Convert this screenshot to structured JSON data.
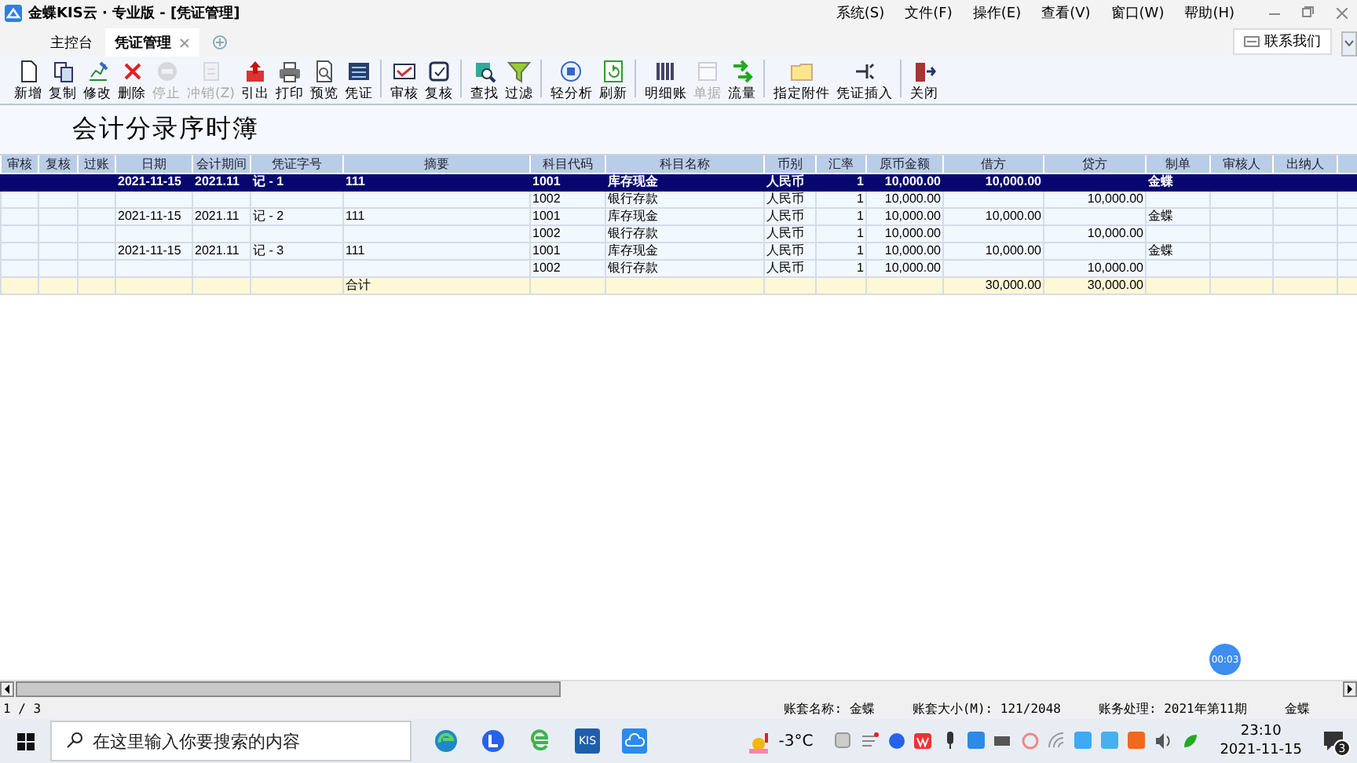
{
  "window": {
    "title": "金蝶KIS云 · 专业版 - [凭证管理]"
  },
  "menu": [
    "系统(S)",
    "文件(F)",
    "操作(E)",
    "查看(V)",
    "窗口(W)",
    "帮助(H)"
  ],
  "tabs": [
    {
      "label": "主控台",
      "selected": false
    },
    {
      "label": "凭证管理",
      "selected": true
    }
  ],
  "contact_button": "联系我们",
  "toolbar": [
    {
      "label": "新增",
      "disabled": false
    },
    {
      "label": "复制",
      "disabled": false
    },
    {
      "label": "修改",
      "disabled": false
    },
    {
      "label": "删除",
      "disabled": false
    },
    {
      "label": "停止",
      "disabled": true
    },
    {
      "label": "冲销(Z)",
      "disabled": true
    },
    {
      "label": "引出",
      "disabled": false
    },
    {
      "label": "打印",
      "disabled": false
    },
    {
      "label": "预览",
      "disabled": false
    },
    {
      "label": "凭证",
      "disabled": false
    },
    {
      "label": "审核",
      "disabled": false,
      "group_start": true
    },
    {
      "label": "复核",
      "disabled": false
    },
    {
      "label": "查找",
      "disabled": false,
      "group_start": true
    },
    {
      "label": "过滤",
      "disabled": false
    },
    {
      "label": "轻分析",
      "disabled": false,
      "group_start": true
    },
    {
      "label": "刷新",
      "disabled": false
    },
    {
      "label": "明细账",
      "disabled": false,
      "group_start": true
    },
    {
      "label": "单据",
      "disabled": true
    },
    {
      "label": "流量",
      "disabled": false
    },
    {
      "label": "指定附件",
      "disabled": false,
      "group_start": true
    },
    {
      "label": "凭证插入",
      "disabled": false
    },
    {
      "label": "关闭",
      "disabled": false,
      "group_start": true
    }
  ],
  "report_title": "会计分录序时簿",
  "table": {
    "columns": [
      "审核",
      "复核",
      "过账",
      "日期",
      "会计期间",
      "凭证字号",
      "摘要",
      "科目代码",
      "科目名称",
      "币别",
      "汇率",
      "原币金额",
      "借方",
      "贷方",
      "制单",
      "审核人",
      "出纳人"
    ],
    "rows": [
      {
        "kind": "entry",
        "selected": true,
        "date": "2021-11-15",
        "period": "2021.11",
        "voucher_no": "记 - 1",
        "summary": "111",
        "account_code": "1001",
        "account_name": "库存现金",
        "currency": "人民币",
        "rate": "1",
        "original_amount": "10,000.00",
        "debit": "10,000.00",
        "preparer": "金蝶"
      },
      {
        "kind": "entry",
        "selected": false,
        "account_code": "1002",
        "account_name": "银行存款",
        "currency": "人民币",
        "rate": "1",
        "original_amount": "10,000.00",
        "credit": "10,000.00"
      },
      {
        "kind": "entry",
        "selected": false,
        "date": "2021-11-15",
        "period": "2021.11",
        "voucher_no": "记 - 2",
        "summary": "111",
        "account_code": "1001",
        "account_name": "库存现金",
        "currency": "人民币",
        "rate": "1",
        "original_amount": "10,000.00",
        "debit": "10,000.00",
        "preparer": "金蝶"
      },
      {
        "kind": "entry",
        "selected": false,
        "account_code": "1002",
        "account_name": "银行存款",
        "currency": "人民币",
        "rate": "1",
        "original_amount": "10,000.00",
        "credit": "10,000.00"
      },
      {
        "kind": "entry",
        "selected": false,
        "date": "2021-11-15",
        "period": "2021.11",
        "voucher_no": "记 - 3",
        "summary": "111",
        "account_code": "1001",
        "account_name": "库存现金",
        "currency": "人民币",
        "rate": "1",
        "original_amount": "10,000.00",
        "debit": "10,000.00",
        "preparer": "金蝶"
      },
      {
        "kind": "entry",
        "selected": false,
        "account_code": "1002",
        "account_name": "银行存款",
        "currency": "人民币",
        "rate": "1",
        "original_amount": "10,000.00",
        "credit": "10,000.00"
      },
      {
        "kind": "total",
        "selected": false,
        "summary": "合计",
        "debit": "30,000.00",
        "credit": "30,000.00"
      }
    ]
  },
  "recorder_badge": "00:03",
  "status_bar": {
    "page": "1 / 3",
    "items": [
      "账套名称: 金蝶",
      "账套大小(M): 121/2048",
      "账务处理: 2021年第11期",
      "金蝶"
    ]
  },
  "taskbar": {
    "search_placeholder": "在这里输入你要搜索的内容",
    "app_label": "KIS",
    "weather": "-3°C",
    "time": "23:10",
    "date": "2021-11-15",
    "notifications": "3"
  }
}
